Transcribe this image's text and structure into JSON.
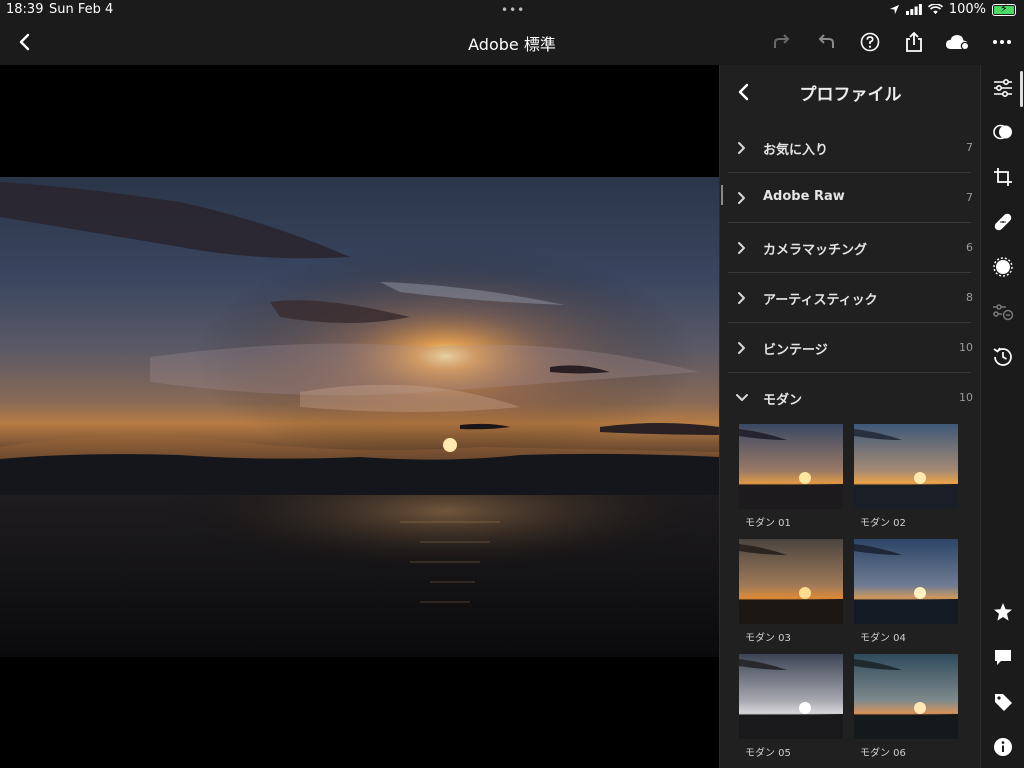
{
  "status": {
    "time": "18:39",
    "date": "Sun Feb 4",
    "battery": "100%",
    "multitask_dots": "•••"
  },
  "header": {
    "title": "Adobe 標準"
  },
  "panel": {
    "title": "プロファイル",
    "groups": [
      {
        "label": "お気に入り",
        "count": "7",
        "expanded": false
      },
      {
        "label": "Adobe Raw",
        "count": "7",
        "expanded": false
      },
      {
        "label": "カメラマッチング",
        "count": "6",
        "expanded": false
      },
      {
        "label": "アーティスティック",
        "count": "8",
        "expanded": false
      },
      {
        "label": "ビンテージ",
        "count": "10",
        "expanded": false
      },
      {
        "label": "モダン",
        "count": "10",
        "expanded": true
      }
    ],
    "thumbnails": [
      {
        "label": "モダン 01"
      },
      {
        "label": "モダン 02"
      },
      {
        "label": "モダン 03"
      },
      {
        "label": "モダン 04"
      },
      {
        "label": "モダン 05"
      },
      {
        "label": "モダン 06"
      }
    ]
  },
  "icons": {
    "top": [
      "back-icon",
      "redo-icon",
      "undo-icon",
      "help-icon",
      "share-icon",
      "cloud-sync-icon",
      "more-icon"
    ],
    "rail": [
      "edit-sliders-icon",
      "presets-icon",
      "crop-icon",
      "healing-icon",
      "masking-icon",
      "versions-icon",
      "history-icon",
      "star-icon",
      "comment-icon",
      "tag-icon",
      "info-icon"
    ]
  },
  "colors": {
    "background": "#1b1b1b",
    "panel": "#202020",
    "battery": "#4cd964"
  }
}
